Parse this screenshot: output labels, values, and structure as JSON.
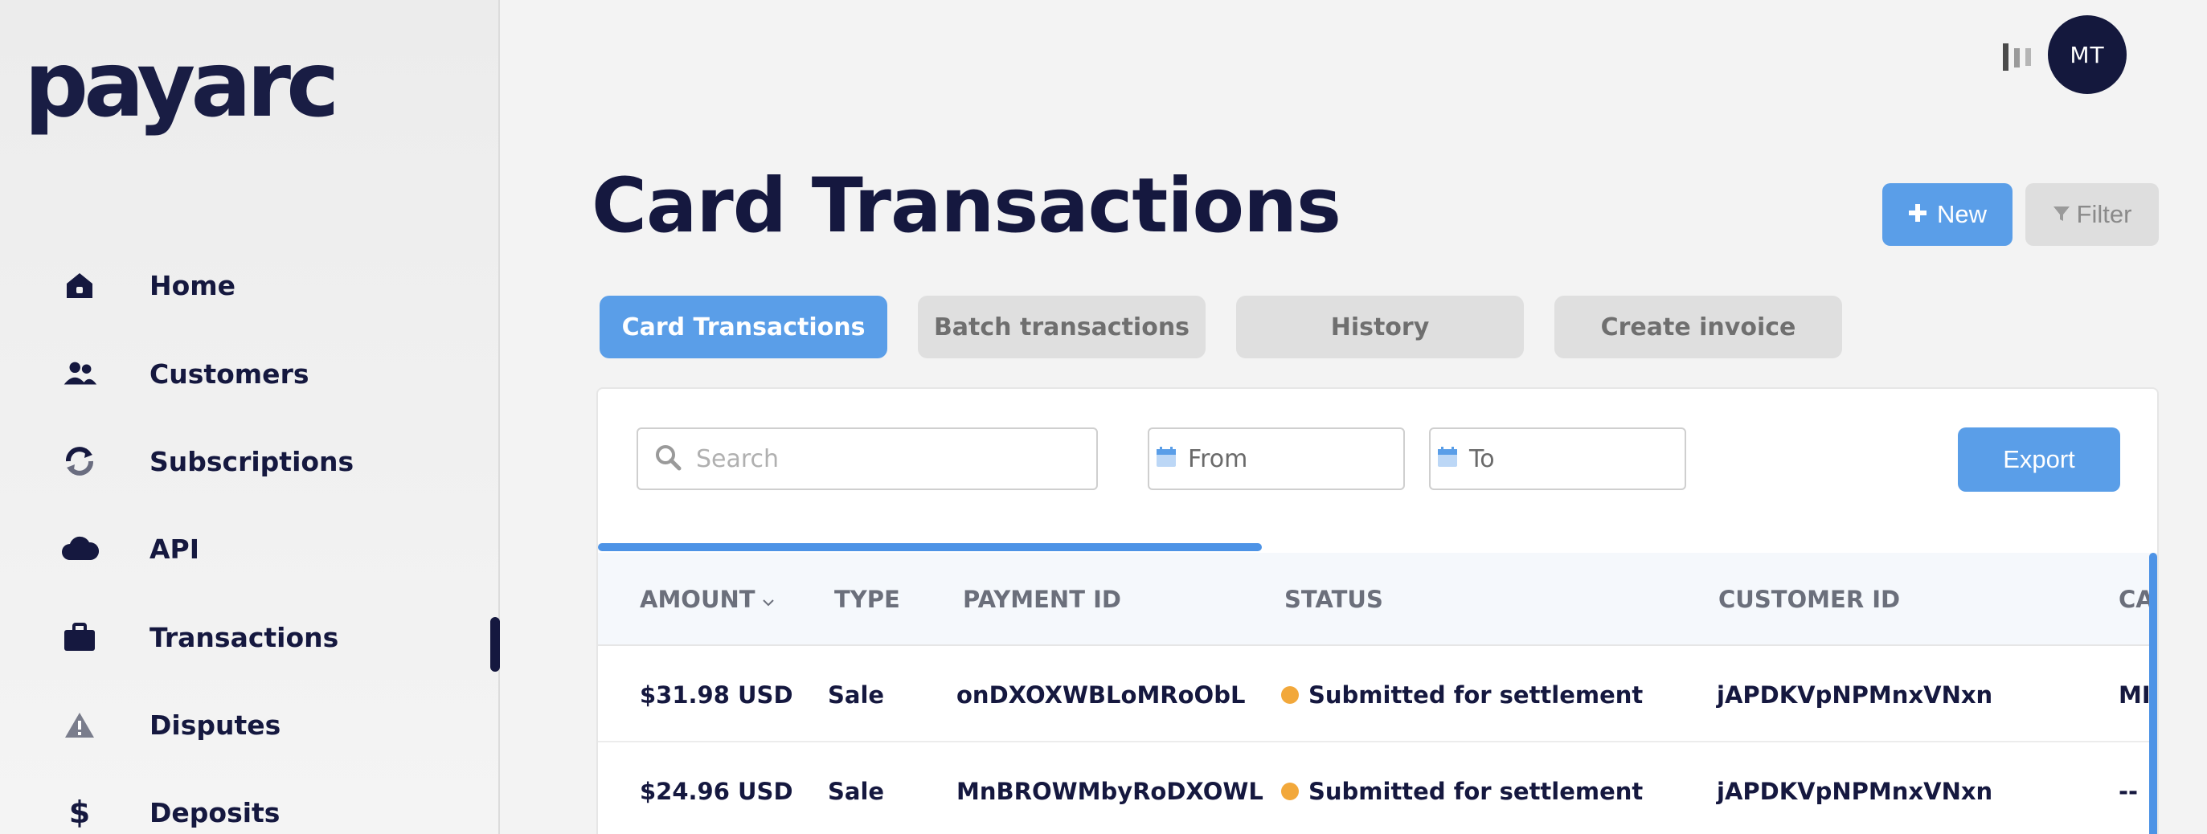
{
  "brand": {
    "logo_text": "payarc"
  },
  "user": {
    "initials": "MT"
  },
  "sidebar": {
    "items": [
      {
        "label": "Home",
        "icon": "home-icon"
      },
      {
        "label": "Customers",
        "icon": "users-icon"
      },
      {
        "label": "Subscriptions",
        "icon": "refresh-icon"
      },
      {
        "label": "API",
        "icon": "cloud-icon"
      },
      {
        "label": "Transactions",
        "icon": "briefcase-icon",
        "active": true
      },
      {
        "label": "Disputes",
        "icon": "warning-icon"
      },
      {
        "label": "Deposits",
        "icon": "dollar-icon"
      }
    ]
  },
  "page": {
    "title": "Card Transactions",
    "new_label": "New",
    "filter_label": "Filter"
  },
  "tabs": [
    "Card Transactions",
    "Batch transactions",
    "History",
    "Create invoice"
  ],
  "toolbar": {
    "search_placeholder": "Search",
    "from_label": "From",
    "to_label": "To",
    "export_label": "Export"
  },
  "table": {
    "columns": [
      "AMOUNT",
      "TYPE",
      "PAYMENT ID",
      "STATUS",
      "CUSTOMER ID",
      "CA"
    ],
    "rows": [
      {
        "amount": "$31.98 USD",
        "type": "Sale",
        "payment_id": "onDXOXWBLoMRoObL",
        "status": "Submitted for settlement",
        "customer_id": "jAPDKVpNPMnxVNxn",
        "extra": "MIl"
      },
      {
        "amount": "$24.96 USD",
        "type": "Sale",
        "payment_id": "MnBROWMbyRoDXOWL",
        "status": "Submitted for settlement",
        "customer_id": "jAPDKVpNPMnxVNxn",
        "extra": "--"
      }
    ]
  },
  "colors": {
    "accent": "#5a9ee8",
    "navy": "#15183f",
    "status_pending": "#f2a83b"
  }
}
